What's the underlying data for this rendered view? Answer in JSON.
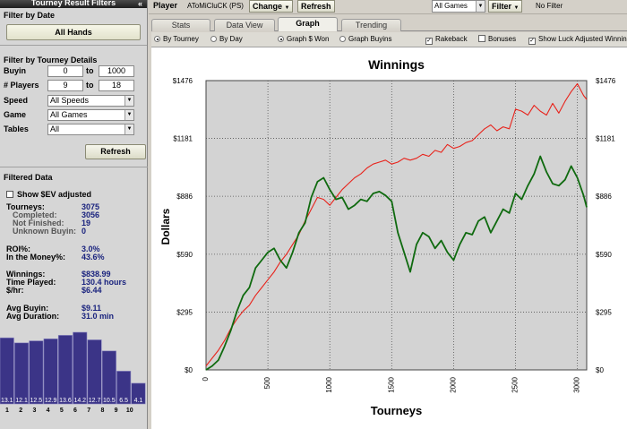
{
  "left_panel": {
    "title": "Tourney Result Filters",
    "filter_by_date": {
      "heading": "Filter by Date",
      "all_hands_label": "All Hands"
    },
    "filter_by_details": {
      "heading": "Filter by Tourney Details",
      "buyin": {
        "label": "Buyin",
        "from": "0",
        "to_label": "to",
        "to": "1000"
      },
      "players": {
        "label": "# Players",
        "from": "9",
        "to_label": "to",
        "to": "18"
      },
      "speed": {
        "label": "Speed",
        "value": "All Speeds"
      },
      "game": {
        "label": "Game",
        "value": "All Games"
      },
      "tables": {
        "label": "Tables",
        "value": "All"
      }
    },
    "refresh_label": "Refresh",
    "filtered_data": {
      "heading": "Filtered Data",
      "show_sev_label": "Show $EV adjusted",
      "stats": [
        {
          "label": "Tourneys:",
          "value": "3075",
          "sub": false,
          "y": 227
        },
        {
          "label": "Completed:",
          "value": "3056",
          "sub": true,
          "y": 236
        },
        {
          "label": "Not Finished:",
          "value": "19",
          "sub": true,
          "y": 245
        },
        {
          "label": "Unknown Buyin:",
          "value": "0",
          "sub": true,
          "y": 254
        },
        {
          "label": "ROI%:",
          "value": "3.0%",
          "sub": false,
          "y": 274
        },
        {
          "label": "In the Money%:",
          "value": "43.6%",
          "sub": false,
          "y": 283
        },
        {
          "label": "Winnings:",
          "value": "$838.99",
          "sub": false,
          "y": 302
        },
        {
          "label": "Time Played:",
          "value": "130.4 hours",
          "sub": false,
          "y": 311
        },
        {
          "label": "$/hr:",
          "value": "$6.44",
          "sub": false,
          "y": 320
        },
        {
          "label": "Avg Buyin:",
          "value": "$9.11",
          "sub": false,
          "y": 340
        },
        {
          "label": "Avg Duration:",
          "value": "31.0 min",
          "sub": false,
          "y": 349
        }
      ]
    },
    "histogram": {
      "bars": [
        {
          "label": "13.1",
          "pos": "1",
          "value": 13.1
        },
        {
          "label": "12.1",
          "pos": "2",
          "value": 12.1
        },
        {
          "label": "12.5",
          "pos": "3",
          "value": 12.5
        },
        {
          "label": "12.9",
          "pos": "3",
          "value": 12.9
        },
        {
          "label": "13.6",
          "pos": "4",
          "value": 13.6
        },
        {
          "label": "14.2",
          "pos": "5",
          "value": 14.2
        },
        {
          "label": "12.7",
          "pos": "6",
          "value": 12.7
        },
        {
          "label": "10.5",
          "pos": "7",
          "value": 10.5
        },
        {
          "label": "6.5",
          "pos": "8",
          "value": 6.5
        },
        {
          "label": "4.1",
          "pos": "9",
          "value": 4.1
        }
      ],
      "axis_labels": [
        "1",
        "2",
        "3",
        "4",
        "5",
        "6",
        "7",
        "8",
        "9",
        "10"
      ]
    }
  },
  "topbar": {
    "player_label": "Player",
    "player_name": "AToMiCluCK (PS)",
    "change_label": "Change",
    "refresh_label": "Refresh",
    "games_value": "All Games",
    "filter_label": "Filter",
    "filter_status": "No Filter"
  },
  "tabs": [
    {
      "label": "Stats",
      "active": false
    },
    {
      "label": "Data View",
      "active": false
    },
    {
      "label": "Graph",
      "active": true
    },
    {
      "label": "Trending",
      "active": false
    }
  ],
  "options": {
    "by_tourney": "By Tourney",
    "by_day": "By Day",
    "graph_won": "Graph $ Won",
    "graph_buyins": "Graph Buyins",
    "rakeback": "Rakeback",
    "bonuses": "Bonuses",
    "luck": "Show Luck Adjusted Winnings"
  },
  "chart_data": {
    "type": "line",
    "title": "Winnings",
    "xlabel": "Tourneys",
    "ylabel": "Dollars",
    "xlim": [
      0,
      3075
    ],
    "ylim": [
      0,
      1476
    ],
    "x_ticks": [
      0,
      500,
      1000,
      1500,
      2000,
      2500,
      3000
    ],
    "y_ticks": [
      "$0",
      "$295",
      "$590",
      "$886",
      "$1181",
      "$1476"
    ],
    "grid": true,
    "series": [
      {
        "color": "#e8231b",
        "x": [
          0,
          50,
          100,
          150,
          200,
          250,
          300,
          350,
          400,
          450,
          500,
          550,
          600,
          650,
          700,
          750,
          800,
          850,
          900,
          950,
          1000,
          1050,
          1100,
          1150,
          1200,
          1250,
          1300,
          1350,
          1400,
          1450,
          1500,
          1550,
          1600,
          1650,
          1700,
          1750,
          1800,
          1850,
          1900,
          1950,
          2000,
          2050,
          2100,
          2150,
          2200,
          2250,
          2300,
          2350,
          2400,
          2450,
          2500,
          2550,
          2600,
          2650,
          2700,
          2750,
          2800,
          2850,
          2900,
          2950,
          3000,
          3050,
          3075
        ],
        "y": [
          20,
          60,
          100,
          150,
          210,
          260,
          300,
          330,
          380,
          420,
          460,
          500,
          550,
          590,
          640,
          690,
          760,
          820,
          880,
          870,
          840,
          880,
          920,
          950,
          980,
          1000,
          1030,
          1050,
          1060,
          1070,
          1050,
          1060,
          1080,
          1070,
          1080,
          1100,
          1090,
          1120,
          1110,
          1150,
          1130,
          1140,
          1160,
          1170,
          1200,
          1230,
          1250,
          1220,
          1240,
          1230,
          1330,
          1320,
          1300,
          1350,
          1320,
          1300,
          1360,
          1310,
          1370,
          1420,
          1460,
          1400,
          1380
        ]
      },
      {
        "color": "#0f6a0f",
        "x": [
          0,
          50,
          100,
          150,
          200,
          250,
          300,
          350,
          400,
          450,
          500,
          550,
          600,
          650,
          700,
          750,
          800,
          850,
          900,
          950,
          1000,
          1050,
          1100,
          1150,
          1200,
          1250,
          1300,
          1350,
          1400,
          1450,
          1500,
          1550,
          1600,
          1650,
          1700,
          1750,
          1800,
          1850,
          1900,
          1950,
          2000,
          2050,
          2100,
          2150,
          2200,
          2250,
          2300,
          2350,
          2400,
          2450,
          2500,
          2550,
          2600,
          2650,
          2700,
          2750,
          2800,
          2850,
          2900,
          2950,
          3000,
          3050,
          3075
        ],
        "y": [
          0,
          20,
          50,
          120,
          200,
          300,
          380,
          420,
          520,
          560,
          600,
          620,
          560,
          520,
          600,
          700,
          750,
          880,
          960,
          980,
          920,
          870,
          880,
          820,
          840,
          870,
          860,
          900,
          910,
          890,
          860,
          700,
          600,
          500,
          640,
          700,
          680,
          620,
          660,
          600,
          560,
          640,
          700,
          690,
          760,
          780,
          700,
          760,
          820,
          800,
          900,
          870,
          940,
          1000,
          1090,
          1010,
          950,
          940,
          970,
          1040,
          980,
          890,
          830
        ]
      }
    ]
  }
}
